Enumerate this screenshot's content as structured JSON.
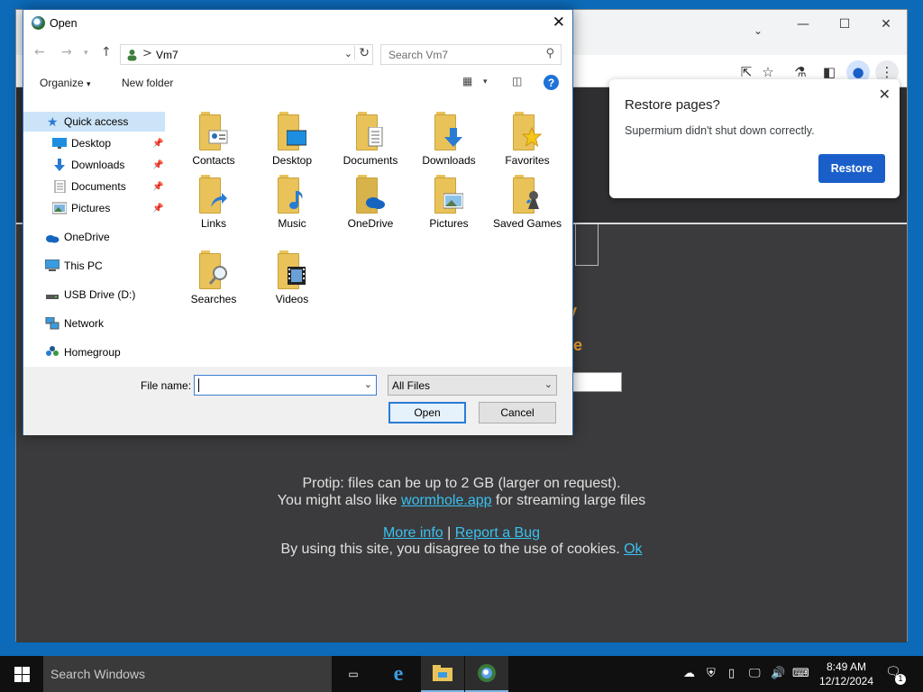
{
  "browser": {
    "restore_popup": {
      "title": "Restore pages?",
      "message": "Supermium didn't shut down correctly.",
      "button": "Restore"
    },
    "content": {
      "protip": "Protip: files can be up to 2 GB (larger on request).",
      "also_like_prefix": "You might also like",
      "also_like_link": "wormhole.app",
      "also_like_suffix": "for streaming large files",
      "more_info": "More info",
      "separator": "|",
      "report_bug": "Report a Bug",
      "cookies_text": "By using this site, you disagree to the use of cookies.",
      "ok_link": "Ok",
      "accent_text_1": "y",
      "accent_text_2": "e"
    }
  },
  "dialog": {
    "title": "Open",
    "address": {
      "separator": ">",
      "location": "Vm7"
    },
    "search_placeholder": "Search Vm7",
    "toolbar": {
      "organize": "Organize",
      "new_folder": "New folder"
    },
    "sidebar": [
      {
        "label": "Quick access",
        "icon": "star-icon",
        "selected": true
      },
      {
        "label": "Desktop",
        "icon": "desktop-icon",
        "pinned": true
      },
      {
        "label": "Downloads",
        "icon": "download-icon",
        "pinned": true
      },
      {
        "label": "Documents",
        "icon": "document-icon",
        "pinned": true
      },
      {
        "label": "Pictures",
        "icon": "picture-icon",
        "pinned": true
      },
      {
        "label": "OneDrive",
        "icon": "cloud-icon"
      },
      {
        "label": "This PC",
        "icon": "computer-icon"
      },
      {
        "label": "USB Drive (D:)",
        "icon": "drive-icon"
      },
      {
        "label": "Network",
        "icon": "network-icon"
      },
      {
        "label": "Homegroup",
        "icon": "homegroup-icon"
      }
    ],
    "files": [
      {
        "label": "Contacts",
        "icon": "contacts-folder-icon"
      },
      {
        "label": "Desktop",
        "icon": "desktop-folder-icon"
      },
      {
        "label": "Documents",
        "icon": "documents-folder-icon"
      },
      {
        "label": "Downloads",
        "icon": "downloads-folder-icon"
      },
      {
        "label": "Favorites",
        "icon": "favorites-folder-icon"
      },
      {
        "label": "Links",
        "icon": "links-folder-icon"
      },
      {
        "label": "Music",
        "icon": "music-folder-icon"
      },
      {
        "label": "OneDrive",
        "icon": "onedrive-folder-icon"
      },
      {
        "label": "Pictures",
        "icon": "pictures-folder-icon"
      },
      {
        "label": "Saved Games",
        "icon": "saved-games-folder-icon"
      },
      {
        "label": "Searches",
        "icon": "searches-folder-icon"
      },
      {
        "label": "Videos",
        "icon": "videos-folder-icon"
      }
    ],
    "file_name_label": "File name:",
    "file_name_value": "",
    "file_type": "All Files",
    "open_button": "Open",
    "cancel_button": "Cancel"
  },
  "taskbar": {
    "search_placeholder": "Search Windows",
    "time": "8:49 AM",
    "date": "12/12/2024",
    "notification_count": "1"
  },
  "colors": {
    "desktop": "#0c6ab8",
    "page_bg": "#3b3b3d",
    "accent": "#f0a030",
    "link": "#3ac1f0",
    "restore_button": "#1a5fc9",
    "selection": "#cce4f7"
  }
}
